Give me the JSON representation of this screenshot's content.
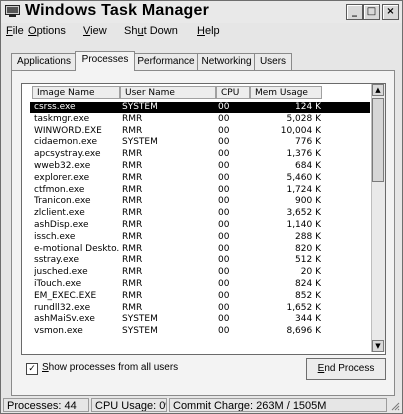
{
  "window": {
    "title": "Windows Task Manager",
    "minimize_label": "_",
    "maximize_label": "□",
    "close_label": "×"
  },
  "menu": [
    {
      "accel": "F",
      "rest": "ile"
    },
    {
      "accel": "O",
      "rest": "ptions"
    },
    {
      "accel": "V",
      "rest": "iew"
    },
    {
      "pre": "Sh",
      "accel": "u",
      "rest": "t Down"
    },
    {
      "accel": "H",
      "rest": "elp"
    }
  ],
  "tabs": [
    {
      "label": "Applications",
      "active": false
    },
    {
      "label": "Processes",
      "active": true
    },
    {
      "label": "Performance",
      "active": false
    },
    {
      "label": "Networking",
      "active": false
    },
    {
      "label": "Users",
      "active": false
    }
  ],
  "columns": [
    "Image Name",
    "User Name",
    "CPU",
    "Mem Usage"
  ],
  "rows": [
    {
      "name": "csrss.exe",
      "user": "SYSTEM",
      "cpu": "00",
      "mem": "124 K",
      "selected": true
    },
    {
      "name": "taskmgr.exe",
      "user": "RMR",
      "cpu": "00",
      "mem": "5,028 K"
    },
    {
      "name": "WINWORD.EXE",
      "user": "RMR",
      "cpu": "00",
      "mem": "10,004 K"
    },
    {
      "name": "cidaemon.exe",
      "user": "SYSTEM",
      "cpu": "00",
      "mem": "776 K"
    },
    {
      "name": "apcsystray.exe",
      "user": "RMR",
      "cpu": "00",
      "mem": "1,376 K"
    },
    {
      "name": "wweb32.exe",
      "user": "RMR",
      "cpu": "00",
      "mem": "684 K"
    },
    {
      "name": "explorer.exe",
      "user": "RMR",
      "cpu": "00",
      "mem": "5,460 K"
    },
    {
      "name": "ctfmon.exe",
      "user": "RMR",
      "cpu": "00",
      "mem": "1,724 K"
    },
    {
      "name": "Tranicon.exe",
      "user": "RMR",
      "cpu": "00",
      "mem": "900 K"
    },
    {
      "name": "zlclient.exe",
      "user": "RMR",
      "cpu": "00",
      "mem": "3,652 K"
    },
    {
      "name": "ashDisp.exe",
      "user": "RMR",
      "cpu": "00",
      "mem": "1,140 K"
    },
    {
      "name": "issch.exe",
      "user": "RMR",
      "cpu": "00",
      "mem": "288 K"
    },
    {
      "name": "e-motional Deskto...",
      "user": "RMR",
      "cpu": "00",
      "mem": "820 K"
    },
    {
      "name": "sstray.exe",
      "user": "RMR",
      "cpu": "00",
      "mem": "512 K"
    },
    {
      "name": "jusched.exe",
      "user": "RMR",
      "cpu": "00",
      "mem": "20 K"
    },
    {
      "name": "iTouch.exe",
      "user": "RMR",
      "cpu": "00",
      "mem": "824 K"
    },
    {
      "name": "EM_EXEC.EXE",
      "user": "RMR",
      "cpu": "00",
      "mem": "852 K"
    },
    {
      "name": "rundll32.exe",
      "user": "RMR",
      "cpu": "00",
      "mem": "1,652 K"
    },
    {
      "name": "ashMaiSv.exe",
      "user": "SYSTEM",
      "cpu": "00",
      "mem": "344 K"
    },
    {
      "name": "vsmon.exe",
      "user": "SYSTEM",
      "cpu": "00",
      "mem": "8,696 K"
    }
  ],
  "show_all": {
    "accel": "S",
    "rest": "how processes from all users",
    "checked": true,
    "check_mark": "✓"
  },
  "end_process": {
    "accel": "E",
    "rest": "nd Process"
  },
  "status": {
    "processes": "Processes: 44",
    "cpu": "CPU Usage: 0%",
    "commit": "Commit Charge: 263M / 1505M"
  }
}
